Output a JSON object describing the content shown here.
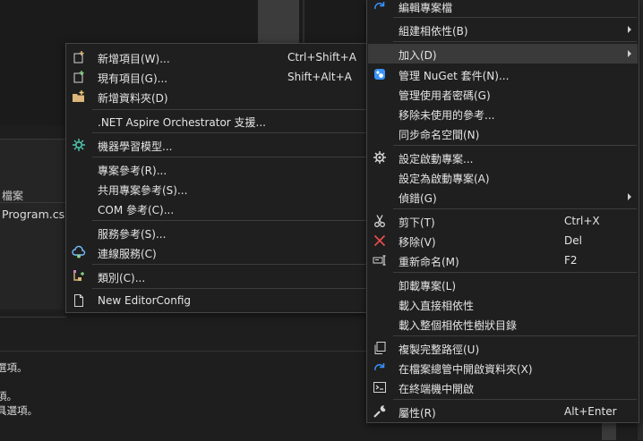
{
  "background": {
    "solution_header": "檔案",
    "solution_file": "Program.cs",
    "output_lines": [
      "選項。",
      "。",
      "項。",
      "具選項。"
    ]
  },
  "left_menu": {
    "items": [
      {
        "label": "新增項目(W)...",
        "shortcut": "Ctrl+Shift+A",
        "icon": "new-item-icon"
      },
      {
        "label": "現有項目(G)...",
        "shortcut": "Shift+Alt+A",
        "icon": "existing-item-icon"
      },
      {
        "label": "新增資料夾(D)",
        "shortcut": "",
        "icon": "new-folder-icon"
      },
      {
        "label": ".NET Aspire Orchestrator 支援...",
        "shortcut": "",
        "icon": ""
      },
      {
        "label": "機器學習模型...",
        "shortcut": "",
        "icon": "machine-learning-icon"
      },
      {
        "label": "專案參考(R)...",
        "shortcut": "",
        "icon": ""
      },
      {
        "label": "共用專案參考(S)...",
        "shortcut": "",
        "icon": ""
      },
      {
        "label": "COM 參考(C)...",
        "shortcut": "",
        "icon": ""
      },
      {
        "label": "服務參考(S)...",
        "shortcut": "",
        "icon": ""
      },
      {
        "label": "連線服務(C)",
        "shortcut": "",
        "icon": "connected-service-icon"
      },
      {
        "label": "類別(C)...",
        "shortcut": "",
        "icon": "class-icon"
      },
      {
        "label": "New EditorConfig",
        "shortcut": "",
        "icon": "editorconfig-file-icon"
      }
    ]
  },
  "right_menu": {
    "items": [
      {
        "label": "編輯專案檔",
        "shortcut": "",
        "icon": "refresh-arrow-icon"
      },
      {
        "label": "組建相依性(B)",
        "shortcut": "",
        "icon": ""
      },
      {
        "label": "加入(D)",
        "shortcut": "",
        "icon": ""
      },
      {
        "label": "管理 NuGet 套件(N)...",
        "shortcut": "",
        "icon": "nuget-icon"
      },
      {
        "label": "管理使用者密碼(G)",
        "shortcut": "",
        "icon": ""
      },
      {
        "label": "移除未使用的參考...",
        "shortcut": "",
        "icon": ""
      },
      {
        "label": "同步命名空間(N)",
        "shortcut": "",
        "icon": ""
      },
      {
        "label": "設定啟動專案...",
        "shortcut": "",
        "icon": "gear-icon"
      },
      {
        "label": "設定為啟動專案(A)",
        "shortcut": "",
        "icon": ""
      },
      {
        "label": "偵錯(G)",
        "shortcut": "",
        "icon": ""
      },
      {
        "label": "剪下(T)",
        "shortcut": "Ctrl+X",
        "icon": "scissors-icon"
      },
      {
        "label": "移除(V)",
        "shortcut": "Del",
        "icon": "remove-x-icon"
      },
      {
        "label": "重新命名(M)",
        "shortcut": "F2",
        "icon": "rename-icon"
      },
      {
        "label": "卸載專案(L)",
        "shortcut": "",
        "icon": ""
      },
      {
        "label": "載入直接相依性",
        "shortcut": "",
        "icon": ""
      },
      {
        "label": "載入整個相依性樹狀目錄",
        "shortcut": "",
        "icon": ""
      },
      {
        "label": "複製完整路徑(U)",
        "shortcut": "",
        "icon": "copy-icon"
      },
      {
        "label": "在檔案總管中開啟資料夾(X)",
        "shortcut": "",
        "icon": "open-folder-arrow-icon"
      },
      {
        "label": "在終端機中開啟",
        "shortcut": "",
        "icon": "terminal-icon"
      },
      {
        "label": "屬性(R)",
        "shortcut": "Alt+Enter",
        "icon": "wrench-icon"
      }
    ]
  },
  "colors": {
    "accent_blue": "#3794ff",
    "remove_red": "#f14c4c",
    "menu_bg": "#1f1f1f",
    "highlight": "#3a3a3a"
  }
}
